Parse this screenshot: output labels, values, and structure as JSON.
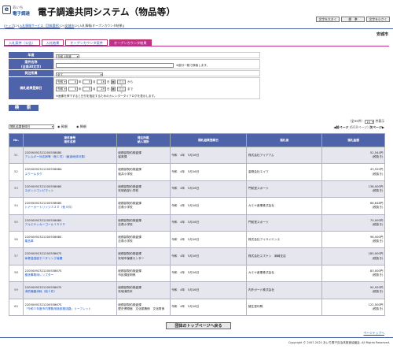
{
  "header": {
    "logo_text_1": "あいち",
    "logo_text_2": "電子調達",
    "title": "電子調達共同システム（物品等）",
    "buttons": [
      "文字を大きく",
      "標　準",
      "文字を小さく"
    ]
  },
  "breadcrumb": {
    "items": [
      "トップ",
      "入札情報サービス（団体選択）",
      "安城市",
      "入札情報(オープンカウンタ結果)"
    ]
  },
  "org_name": "安城市",
  "tabs": [
    "入札案件（公告）",
    "入札結果",
    "オープンカウンタ案件",
    "オープンカウンタ結果"
  ],
  "form": {
    "fiscal_year_label": "年度",
    "fiscal_year_value": "令和 4年度",
    "case_name_label_1": "案件名称",
    "case_name_label_2": "(全角30文字)",
    "case_name_note": "※部分一致で検索します。",
    "office_label": "発注所属",
    "office_value": "全て",
    "date_label": "開札結果登録日",
    "from": {
      "era": "令和",
      "year": "4",
      "month": "5",
      "day": "16",
      "unit_y": "年",
      "unit_m": "月",
      "unit_d": "日",
      "clear": "クリア",
      "suffix": "から"
    },
    "to": {
      "era": "令和",
      "year": "4",
      "month": "5",
      "day": "29",
      "unit_y": "年",
      "unit_m": "月",
      "unit_d": "日",
      "clear": "クリア",
      "suffix": "まで"
    },
    "date_note": "※画像を押下すると日付を指定するためのカレンダーダイアログを表示します。",
    "search_button": "検　索"
  },
  "results": {
    "sort_value": "開札結果登録日",
    "asc_label": "昇順",
    "desc_label": "降順",
    "total": "（全95件）",
    "per_page": "10",
    "per_page_suffix": "件表示",
    "prev": "前ページ",
    "page_info": "(6/10ページ)",
    "next": "次ページ",
    "columns": [
      [
        "No.",
        ""
      ],
      [
        "案件番号",
        "案件名称"
      ],
      [
        "発注所属",
        "納入場所"
      ],
      [
        "開札結果登録日",
        ""
      ],
      [
        "落札者",
        ""
      ],
      [
        "落札金額",
        ""
      ]
    ],
    "rows": [
      {
        "no": "51",
        "case_no": "2205009232120053868S",
        "name": "アレルギー対応卵等（他１件）（献減地体対象）",
        "office": "総務部契約検査課",
        "place": "保育課",
        "date": "令和　4年　5月16日",
        "winner": "株式会社アイデアム",
        "price": "52,544円",
        "tax": "(税抜き)"
      },
      {
        "no": "52",
        "case_no": "2205009232120053868A",
        "name": "スクールタク",
        "office": "総務部契約検査課",
        "place": "桜井小学校",
        "date": "令和　4年　5月16日",
        "winner": "金剛会社エイワ",
        "price": "43,520円",
        "tax": "(税抜き)"
      },
      {
        "no": "53",
        "case_no": "2205009232120053868S",
        "name": "スポンジコンピマット",
        "office": "総務部契約検査課",
        "place": "安城西部小学校",
        "date": "令和　4年　5月16日",
        "winner": "門前堂スポーツ",
        "price": "138,000円",
        "tax": "(税抜き)"
      },
      {
        "no": "54",
        "case_no": "2205009232120053868S",
        "name": "トナーカートリッジ３２０（他４件）",
        "office": "総務部契約検査課",
        "place": "志貴小学校",
        "date": "令和　4年　5月16日",
        "winner": "カミヤ産業株式会社",
        "price": "66,648円",
        "tax": "(税抜き)"
      },
      {
        "no": "55",
        "case_no": "2205009232120053868S",
        "name": "アルミサッカーゴール１５２０",
        "office": "総務部契約検査課",
        "place": "志貴小学校",
        "date": "令和　4年　5月16日",
        "winner": "門前堂スポーツ",
        "price": "70,000円",
        "tax": "(税抜き)"
      },
      {
        "no": "56",
        "case_no": "2205009232120053868S",
        "name": "薬品庫",
        "office": "総務部契約検査課",
        "place": "志貴小学校",
        "date": "令和　4年　5月16日",
        "winner": "株式会社アイサイエンス",
        "price": "98,000円",
        "tax": "(税抜き)"
      },
      {
        "no": "57",
        "case_no": "2205009232120053867S",
        "name": "休業温湿度モニタリング装置",
        "office": "総務部契約検査課",
        "place": "安城市保護センター",
        "date": "令和　4年　5月16日",
        "winner": "株式会社スズケン　岡崎支店",
        "price": "180,000円",
        "tax": "(税抜き)"
      },
      {
        "no": "58",
        "case_no": "2205009232120053867S",
        "name": "樹液事務用レンズター",
        "office": "総務部契約検査課",
        "place": "市民課証明係",
        "date": "令和　4年　5月16日",
        "winner": "カミヤ産業株式会社",
        "price": "83,000円",
        "tax": "(税抜き)"
      },
      {
        "no": "59",
        "case_no": "2205009232120053867S",
        "name": "消防機器消耗（他１件）",
        "office": "総務部契約検査課",
        "place": "安城消防本",
        "date": "令和　4年　5月16日",
        "winner": "内外ガード株式会社",
        "price": "94,920円",
        "tax": "(税抜き)"
      },
      {
        "no": "60",
        "case_no": "2205009232120053867S",
        "name": "「令和３年度市内業務用施設搬送路」リーフレット",
        "office": "総務部契約検査課",
        "place": "歴史博物館　文化振興係　文化財係",
        "date": "令和　4年　5月16日",
        "winner": "猪生堂印刷",
        "price": "122,500円",
        "tax": "(税抜き)"
      }
    ]
  },
  "back_button": "団体のトップページへ戻る",
  "page_top": "ページトップへ",
  "copyright": "Copyright © 2007-2022 あいち電子自治体推進協議会. All Rights Reserved.",
  "colors": {
    "accent": "#4f63ab",
    "tab_active": "#c0318e",
    "row_alt": "#e6e6ef"
  }
}
